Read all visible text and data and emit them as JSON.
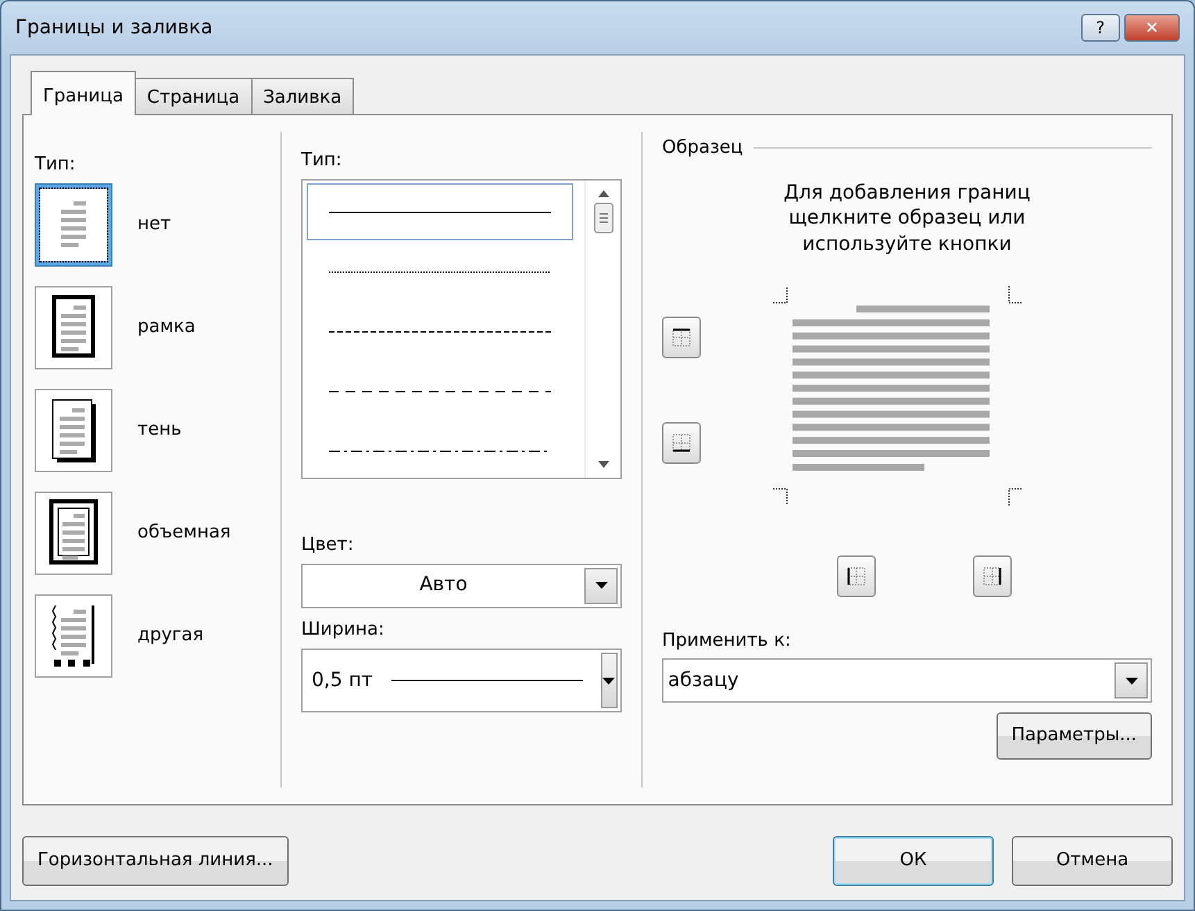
{
  "window": {
    "title": "Границы и заливка",
    "buttons": [
      "?",
      "✕"
    ]
  },
  "tabs": [
    {
      "label": "Граница",
      "selected": true
    },
    {
      "label": "Страница",
      "selected": false
    },
    {
      "label": "Заливка",
      "selected": false
    }
  ],
  "setting": {
    "label": "Тип:",
    "items": [
      {
        "kind": "none",
        "label": "нет",
        "selected": true
      },
      {
        "kind": "box",
        "label": "рамка",
        "selected": false
      },
      {
        "kind": "shadow",
        "label": "тень",
        "selected": false
      },
      {
        "kind": "threed",
        "label": "объемная",
        "selected": false
      },
      {
        "kind": "custom",
        "label": "другая",
        "selected": false
      }
    ]
  },
  "style": {
    "label": "Тип:",
    "items": [
      {
        "kind": "solid",
        "selected": true
      },
      {
        "kind": "dotted",
        "selected": false
      },
      {
        "kind": "dashed",
        "selected": false
      },
      {
        "kind": "long-dash",
        "selected": false
      },
      {
        "kind": "dash-dot",
        "selected": false
      }
    ],
    "color_label": "Цвет:",
    "color_value": "Авто",
    "width_label": "Ширина:",
    "width_value": "0,5 пт"
  },
  "preview": {
    "label": "Образец",
    "hint": "Для добавления границ щелкните образец или используйте кнопки",
    "apply_label": "Применить к:",
    "apply_value": "абзацу",
    "options_button": "Параметры..."
  },
  "footer": {
    "horizontal_line_button": "Горизонтальная линия...",
    "ok_button": "ОК",
    "cancel_button": "Отмена"
  }
}
